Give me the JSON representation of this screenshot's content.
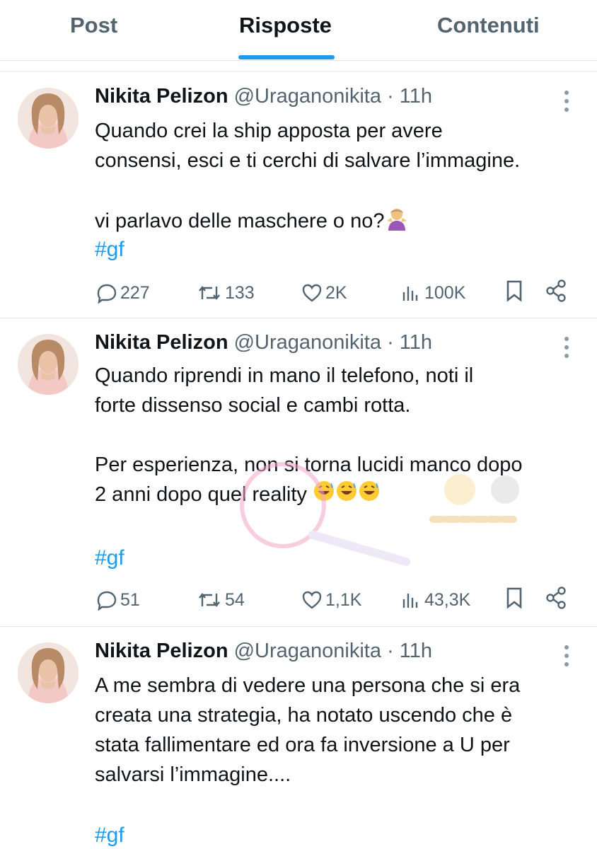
{
  "tabs": [
    {
      "label": "Post",
      "active": false
    },
    {
      "label": "Risposte",
      "active": true
    },
    {
      "label": "Contenuti",
      "active": false
    }
  ],
  "colors": {
    "accent": "#1d9bf0",
    "text": "#0f1419",
    "muted": "#536471"
  },
  "tweets": [
    {
      "name": "Nikita Pelizon",
      "handle": "@Uraganonikita",
      "time": "· 11h",
      "lines": [
        "Quando crei la ship apposta per avere",
        "consensi, esci e ti cerchi di salvare l’immagine.",
        "",
        "vi parlavo delle maschere  o no?"
      ],
      "emoji": "person-shrugging",
      "hashtag": "#gf",
      "replies": "227",
      "retweets": "133",
      "likes": "2K",
      "views": "100K"
    },
    {
      "name": "Nikita Pelizon",
      "handle": "@Uraganonikita",
      "time": "· 11h",
      "lines": [
        "Quando riprendi in mano il telefono, noti il",
        "forte dissenso social e cambi rotta.",
        "",
        "Per esperienza, non si torna lucidi manco dopo",
        "2 anni dopo quel reality"
      ],
      "emoji": "grinning-face-with-sweat",
      "hashtag": "#gf",
      "replies": "51",
      "retweets": "54",
      "likes": "1,1K",
      "views": "43,3K"
    },
    {
      "name": "Nikita Pelizon",
      "handle": "@Uraganonikita",
      "time": "· 11h",
      "lines": [
        "A me sembra di vedere una persona che si era",
        "creata una strategia, ha notato uscendo che è",
        "stata fallimentare ed ora fa inversione a U per",
        "salvarsi l’immagine...."
      ],
      "hashtag": "#gf"
    }
  ]
}
